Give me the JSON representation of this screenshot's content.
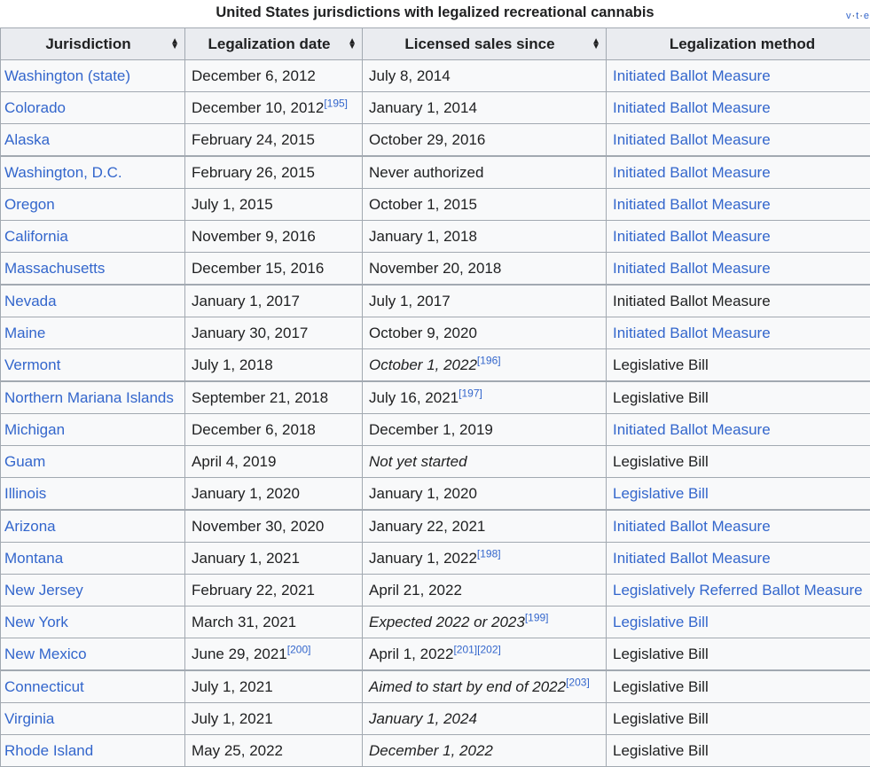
{
  "caption": "United States jurisdictions with legalized recreational cannabis",
  "vte": [
    "v",
    "t",
    "e"
  ],
  "headers": [
    "Jurisdiction",
    "Legalization date",
    "Licensed sales since",
    "Legalization method"
  ],
  "rows": [
    {
      "jurisdiction": "Washington (state)",
      "date": "December 6, 2012",
      "date_ref": "",
      "sales": "July 8, 2014",
      "sales_italic": false,
      "sales_ref": "",
      "method": "Initiated Ballot Measure",
      "method_link": true
    },
    {
      "jurisdiction": "Colorado",
      "date": "December 10, 2012",
      "date_ref": "[195]",
      "sales": "January 1, 2014",
      "sales_italic": false,
      "sales_ref": "",
      "method": "Initiated Ballot Measure",
      "method_link": true
    },
    {
      "jurisdiction": "Alaska",
      "date": "February 24, 2015",
      "date_ref": "",
      "sales": "October 29, 2016",
      "sales_italic": false,
      "sales_ref": "",
      "method": "Initiated Ballot Measure",
      "method_link": true
    },
    {
      "jurisdiction": "Washington, D.C.",
      "date": "February 26, 2015",
      "date_ref": "",
      "sales": "Never authorized",
      "sales_italic": false,
      "sales_ref": "",
      "method": "Initiated Ballot Measure",
      "method_link": true
    },
    {
      "jurisdiction": "Oregon",
      "date": "July 1, 2015",
      "date_ref": "",
      "sales": "October 1, 2015",
      "sales_italic": false,
      "sales_ref": "",
      "method": "Initiated Ballot Measure",
      "method_link": true
    },
    {
      "jurisdiction": "California",
      "date": "November 9, 2016",
      "date_ref": "",
      "sales": "January 1, 2018",
      "sales_italic": false,
      "sales_ref": "",
      "method": "Initiated Ballot Measure",
      "method_link": true
    },
    {
      "jurisdiction": "Massachusetts",
      "date": "December 15, 2016",
      "date_ref": "",
      "sales": "November 20, 2018",
      "sales_italic": false,
      "sales_ref": "",
      "method": "Initiated Ballot Measure",
      "method_link": true
    },
    {
      "jurisdiction": "Nevada",
      "date": "January 1, 2017",
      "date_ref": "",
      "sales": "July 1, 2017",
      "sales_italic": false,
      "sales_ref": "",
      "method": "Initiated Ballot Measure",
      "method_link": false
    },
    {
      "jurisdiction": "Maine",
      "date": "January 30, 2017",
      "date_ref": "",
      "sales": "October 9, 2020",
      "sales_italic": false,
      "sales_ref": "",
      "method": "Initiated Ballot Measure",
      "method_link": true
    },
    {
      "jurisdiction": "Vermont",
      "date": "July 1, 2018",
      "date_ref": "",
      "sales": "October 1, 2022",
      "sales_italic": true,
      "sales_ref": "[196]",
      "method": "Legislative Bill",
      "method_link": false
    },
    {
      "jurisdiction": "Northern Mariana Islands",
      "date": "September 21, 2018",
      "date_ref": "",
      "sales": "July 16, 2021",
      "sales_italic": false,
      "sales_ref": "[197]",
      "method": "Legislative Bill",
      "method_link": false
    },
    {
      "jurisdiction": "Michigan",
      "date": "December 6, 2018",
      "date_ref": "",
      "sales": "December 1, 2019",
      "sales_italic": false,
      "sales_ref": "",
      "method": "Initiated Ballot Measure",
      "method_link": true
    },
    {
      "jurisdiction": "Guam",
      "date": "April 4, 2019",
      "date_ref": "",
      "sales": "Not yet started",
      "sales_italic": true,
      "sales_ref": "",
      "method": "Legislative Bill",
      "method_link": false
    },
    {
      "jurisdiction": "Illinois",
      "date": "January 1, 2020",
      "date_ref": "",
      "sales": "January 1, 2020",
      "sales_italic": false,
      "sales_ref": "",
      "method": "Legislative Bill",
      "method_link": true
    },
    {
      "jurisdiction": "Arizona",
      "date": "November 30, 2020",
      "date_ref": "",
      "sales": "January 22, 2021",
      "sales_italic": false,
      "sales_ref": "",
      "method": "Initiated Ballot Measure",
      "method_link": true
    },
    {
      "jurisdiction": "Montana",
      "date": "January 1, 2021",
      "date_ref": "",
      "sales": "January 1, 2022",
      "sales_italic": false,
      "sales_ref": "[198]",
      "method": "Initiated Ballot Measure",
      "method_link": true
    },
    {
      "jurisdiction": "New Jersey",
      "date": "February 22, 2021",
      "date_ref": "",
      "sales": "April 21, 2022",
      "sales_italic": false,
      "sales_ref": "",
      "method": "Legislatively Referred Ballot Measure",
      "method_link": true
    },
    {
      "jurisdiction": "New York",
      "date": "March 31, 2021",
      "date_ref": "",
      "sales": "Expected 2022 or 2023",
      "sales_italic": true,
      "sales_ref": "[199]",
      "method": "Legislative Bill",
      "method_link": true
    },
    {
      "jurisdiction": "New Mexico",
      "date": "June 29, 2021",
      "date_ref": "[200]",
      "sales": "April 1, 2022",
      "sales_italic": false,
      "sales_ref": "[201][202]",
      "method": "Legislative Bill",
      "method_link": false
    },
    {
      "jurisdiction": "Connecticut",
      "date": "July 1, 2021",
      "date_ref": "",
      "sales": "Aimed to start by end of 2022",
      "sales_italic": true,
      "sales_ref": "[203]",
      "method": "Legislative Bill",
      "method_link": false
    },
    {
      "jurisdiction": "Virginia",
      "date": "July 1, 2021",
      "date_ref": "",
      "sales": "January 1, 2024",
      "sales_italic": true,
      "sales_ref": "",
      "method": "Legislative Bill",
      "method_link": false
    },
    {
      "jurisdiction": "Rhode Island",
      "date": "May 25, 2022",
      "date_ref": "",
      "sales": "December 1, 2022",
      "sales_italic": true,
      "sales_ref": "",
      "method": "Legislative Bill",
      "method_link": false
    }
  ],
  "colors": {
    "link": "#3366cc",
    "header_bg": "#eaecf0",
    "cell_bg": "#f8f9fa",
    "border": "#a2a9b1",
    "text": "#202122"
  },
  "icons": {
    "sort": "sort-arrows-icon"
  }
}
